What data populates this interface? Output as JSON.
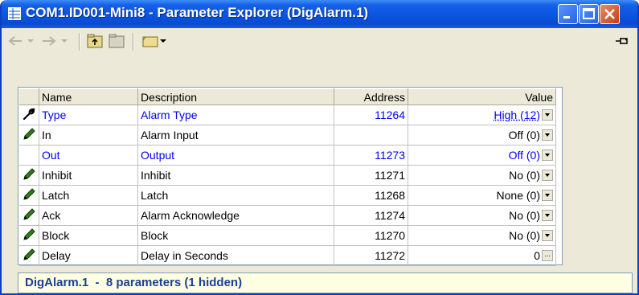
{
  "window": {
    "title": "COM1.ID001-Mini8 - Parameter Explorer (DigAlarm.1)"
  },
  "toolbar": {
    "icons": [
      "back-arrow-icon",
      "forward-arrow-icon",
      "up-folder-icon",
      "folder-icon",
      "folder-menu-icon",
      "pin-icon"
    ]
  },
  "grid": {
    "headers": {
      "name": "Name",
      "description": "Description",
      "address": "Address",
      "value": "Value"
    },
    "rows": [
      {
        "icon": "wrench-icon",
        "name": "Type",
        "description": "Alarm Type",
        "address": "11264",
        "value": "High (12)",
        "control": "dropdown",
        "highlight": true,
        "selected": true
      },
      {
        "icon": "pencil-icon",
        "name": "In",
        "description": "Alarm Input",
        "address": "",
        "value": "Off (0)",
        "control": "dropdown",
        "highlight": false
      },
      {
        "icon": "",
        "name": "Out",
        "description": "Output",
        "address": "11273",
        "value": "Off (0)",
        "control": "dropdown",
        "highlight": true
      },
      {
        "icon": "pencil-icon",
        "name": "Inhibit",
        "description": "Inhibit",
        "address": "11271",
        "value": "No (0)",
        "control": "dropdown",
        "highlight": false
      },
      {
        "icon": "pencil-icon",
        "name": "Latch",
        "description": "Latch",
        "address": "11268",
        "value": "None (0)",
        "control": "dropdown",
        "highlight": false
      },
      {
        "icon": "pencil-icon",
        "name": "Ack",
        "description": "Alarm Acknowledge",
        "address": "11274",
        "value": "No (0)",
        "control": "dropdown",
        "highlight": false
      },
      {
        "icon": "pencil-icon",
        "name": "Block",
        "description": "Block",
        "address": "11270",
        "value": "No (0)",
        "control": "dropdown",
        "highlight": false
      },
      {
        "icon": "pencil-icon",
        "name": "Delay",
        "description": "Delay in Seconds",
        "address": "11272",
        "value": "0",
        "control": "ellipsis",
        "highlight": false
      }
    ]
  },
  "status": {
    "text": "DigAlarm.1  -  8 parameters (1 hidden)"
  },
  "colors": {
    "title_bar": "#0b54e0",
    "highlight_text": "#0000ff",
    "status_text": "#1c3f94",
    "pencil": "#2f7d1a"
  }
}
